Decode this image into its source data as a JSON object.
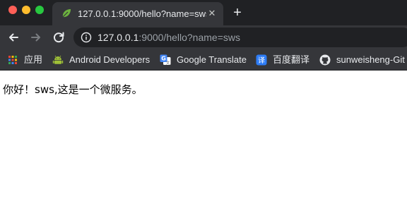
{
  "window": {
    "tab": {
      "title": "127.0.0.1:9000/hello?name=sws",
      "favicon": "leaf-icon"
    },
    "new_tab_symbol": "+",
    "tab_close_symbol": "✕"
  },
  "toolbar": {
    "back_icon": "back-arrow-icon",
    "forward_icon": "forward-arrow-icon",
    "reload_icon": "reload-icon",
    "url_host": "127.0.0.1",
    "url_rest": ":9000/hello?name=sws"
  },
  "bookmarks": [
    {
      "label": "应用",
      "icon": "apps-grid-icon"
    },
    {
      "label": "Android Developers",
      "icon": "android-icon"
    },
    {
      "label": "Google Translate",
      "icon": "translate-icon"
    },
    {
      "label": "百度翻译",
      "icon": "baidu-translate-icon"
    },
    {
      "label": "sunweisheng-Git",
      "icon": "github-icon"
    }
  ],
  "page": {
    "body_text": "你好！sws,这是一个微服务。"
  },
  "colors": {
    "tab_strip": "#202124",
    "toolbar": "#35363a",
    "traffic_close": "#ff5f57",
    "traffic_minimize": "#febc2e",
    "traffic_maximize": "#28c840"
  }
}
